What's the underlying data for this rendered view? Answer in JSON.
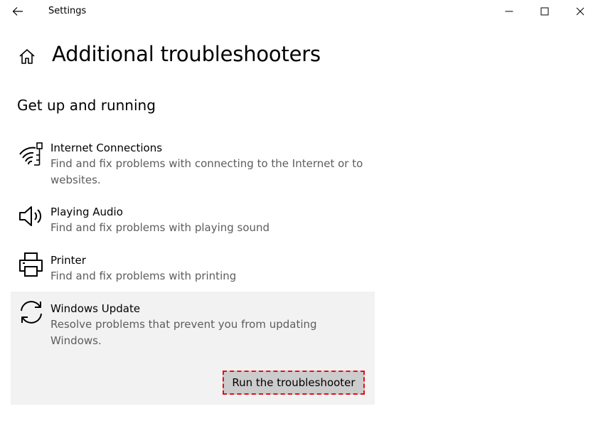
{
  "window": {
    "title": "Settings"
  },
  "header": {
    "title": "Additional troubleshooters"
  },
  "section": {
    "title": "Get up and running"
  },
  "items": [
    {
      "icon": "wifi-network-icon",
      "title": "Internet Connections",
      "description": "Find and fix problems with connecting to the Internet or to websites."
    },
    {
      "icon": "speaker-icon",
      "title": "Playing Audio",
      "description": "Find and fix problems with playing sound"
    },
    {
      "icon": "printer-icon",
      "title": "Printer",
      "description": "Find and fix problems with printing"
    },
    {
      "icon": "sync-arrows-icon",
      "title": "Windows Update",
      "description": "Resolve problems that prevent you from updating Windows.",
      "selected": true,
      "action_label": "Run the troubleshooter"
    }
  ],
  "colors": {
    "selected_background": "#f2f2f2",
    "button_background": "#cccccc",
    "highlight_border": "#e0101a",
    "description_text": "#5d5d5d"
  }
}
